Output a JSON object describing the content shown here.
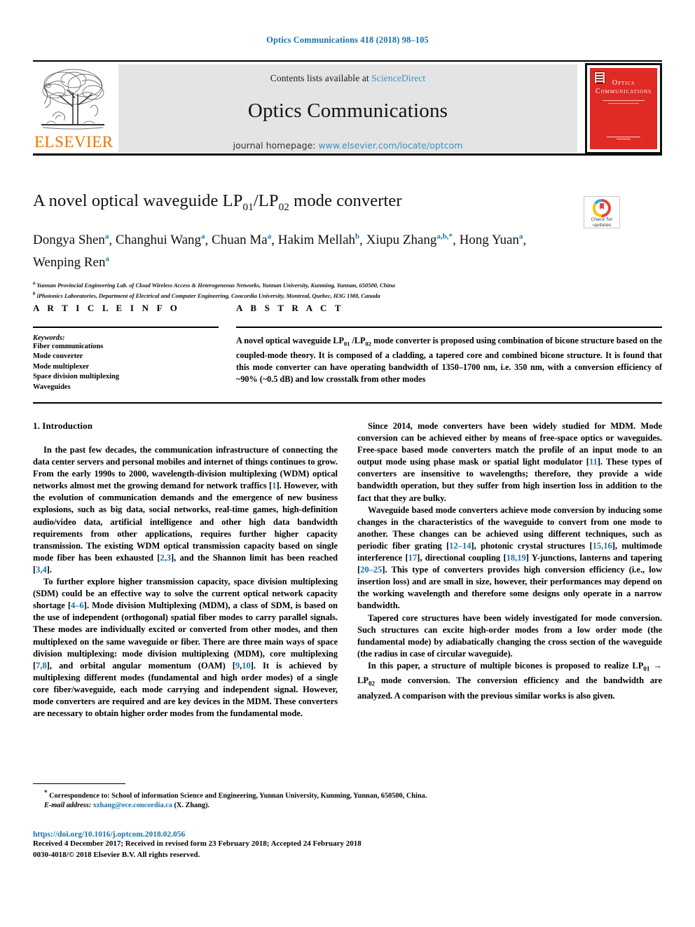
{
  "running_head": "Optics Communications 418 (2018) 98–105",
  "masthead": {
    "contents_prefix": "Contents lists available at",
    "sciencedirect": "ScienceDirect",
    "journal_title": "Optics Communications",
    "homepage_prefix": "journal homepage:",
    "homepage_url": "www.elsevier.com/locate/optcom",
    "publisher": "ELSEVIER",
    "cover_title_line1": "Optics",
    "cover_title_line2": "Communications",
    "colors": {
      "link": "#3a8fc4",
      "running_head": "#1a72a8",
      "elsevier_orange": "#ec7404",
      "cover_red": "#e02a26",
      "band_grey": "#e4e4e4"
    }
  },
  "crossmark": {
    "line1": "Check for",
    "line2": "updates"
  },
  "article": {
    "title_prefix": "A novel optical waveguide LP",
    "title_sub1": "01",
    "title_mid": "/LP",
    "title_sub2": "02",
    "title_suffix": " mode converter",
    "authors": [
      {
        "name": "Dongya Shen",
        "sup": "a"
      },
      {
        "name": "Changhui Wang",
        "sup": "a"
      },
      {
        "name": "Chuan Ma",
        "sup": "a"
      },
      {
        "name": "Hakim Mellah",
        "sup": "b"
      },
      {
        "name": "Xiupu Zhang",
        "sup": "a,b,*"
      },
      {
        "name": "Hong Yuan",
        "sup": "a"
      },
      {
        "name": "Wenping Ren",
        "sup": "a"
      }
    ],
    "affiliations": [
      {
        "label": "a",
        "text": "Yunnan Provincial Engineering Lab. of Cloud Wireless Access & Heterogeneous Networks, Yunnan University, Kunming, Yunnan, 650500, China"
      },
      {
        "label": "b",
        "text": "iPhotonics Laboratories, Department of Electrical and Computer Engineering, Concordia University, Montreal, Quebec, H3G 1M8, Canada"
      }
    ]
  },
  "article_info": {
    "heading": "A R T I C L E   I N F O",
    "keywords_label": "Keywords:",
    "keywords": [
      "Fiber communications",
      "Mode converter",
      "Mode multiplexer",
      "Space division multiplexing",
      "Waveguides"
    ]
  },
  "abstract": {
    "heading": "A B S T R A C T",
    "text_part1": "A novel optical waveguide LP",
    "sub1": "01",
    "text_part2": " /LP",
    "sub2": "02",
    "text_part3": " mode converter is proposed using combination of bicone structure based on the coupled-mode theory. It is composed of a cladding, a tapered core and combined bicone structure. It is found that this mode converter can have operating bandwidth of 1350–1700 nm, i.e. 350 nm, with a conversion efficiency of ~90% (~0.5 dB) and low crosstalk from other modes"
  },
  "body": {
    "section_number_title": "1. Introduction",
    "left_paragraphs": [
      "In the past few decades, the communication infrastructure of connecting the data center servers and personal mobiles and internet of things continues to grow. From the early 1990s to 2000, wavelength-division multiplexing (WDM) optical networks almost met the growing demand for network traffics [1]. However, with the evolution of communication demands and the emergence of new business explosions, such as big data, social networks, real-time games, high-definition audio/video data, artificial intelligence and other high data bandwidth requirements from other applications, requires further higher capacity transmission. The existing WDM optical transmission capacity based on single mode fiber has been exhausted [2,3], and the Shannon limit has been reached [3,4].",
      "To further explore higher transmission capacity, space division multiplexing (SDM) could be an effective way to solve the current optical network capacity shortage [4–6]. Mode division Multiplexing (MDM), a class of SDM, is based on the use of independent (orthogonal) spatial fiber modes to carry parallel signals. These modes are individually excited or converted from other modes, and then multiplexed on the same waveguide or fiber. There are three main ways of space division multiplexing: mode division multiplexing (MDM), core multiplexing [7,8], and orbital angular momentum (OAM) [9,10]. It is achieved by multiplexing different modes (fundamental and high order modes) of a single core fiber/waveguide, each mode carrying and independent signal. However, mode converters are required and are key devices in the MDM. These converters are necessary to obtain higher order modes from the fundamental mode."
    ],
    "right_paragraphs": [
      "Since 2014, mode converters have been widely studied for MDM. Mode conversion can be achieved either by means of free-space optics or waveguides. Free-space based mode converters match the profile of an input mode to an output mode using phase mask or spatial light modulator [11]. These types of converters are insensitive to wavelengths; therefore, they provide a wide bandwidth operation, but they suffer from high insertion loss in addition to the fact that they are bulky.",
      "Waveguide based mode converters achieve mode conversion by inducing some changes in the characteristics of the waveguide to convert from one mode to another. These changes can be achieved using different techniques, such as periodic fiber grating [12–14], photonic crystal structures [15,16], multimode interference [17], directional coupling [18,19] Y-junctions, lanterns and tapering [20–25]. This type of converters provides high conversion efficiency (i.e., low insertion loss) and are small in size, however, their performances may depend on the working wavelength and therefore some designs only operate in a narrow bandwidth.",
      "Tapered core structures have been widely investigated for mode conversion. Such structures can excite high-order modes from a low order mode (the fundamental mode) by adiabatically changing the cross section of the waveguide (the radius in case of circular waveguide).",
      "In this paper, a structure of multiple bicones is proposed to realize LP01 → LP02 mode conversion. The conversion efficiency and the bandwidth are analyzed. A comparison with the previous similar works is also given."
    ]
  },
  "footnotes": {
    "correspondence": "Correspondence to: School of information Science and Engineering, Yunnan University, Kunming, Yunnan, 650500, China.",
    "email_label": "E-mail address:",
    "email": "xzhang@ece.concordia.ca",
    "email_owner": "(X. Zhang)."
  },
  "publication": {
    "doi": "https://doi.org/10.1016/j.optcom.2018.02.056",
    "dates": "Received 4 December 2017; Received in revised form 23 February 2018; Accepted 24 February 2018",
    "copyright": "0030-4018/© 2018 Elsevier B.V. All rights reserved."
  }
}
